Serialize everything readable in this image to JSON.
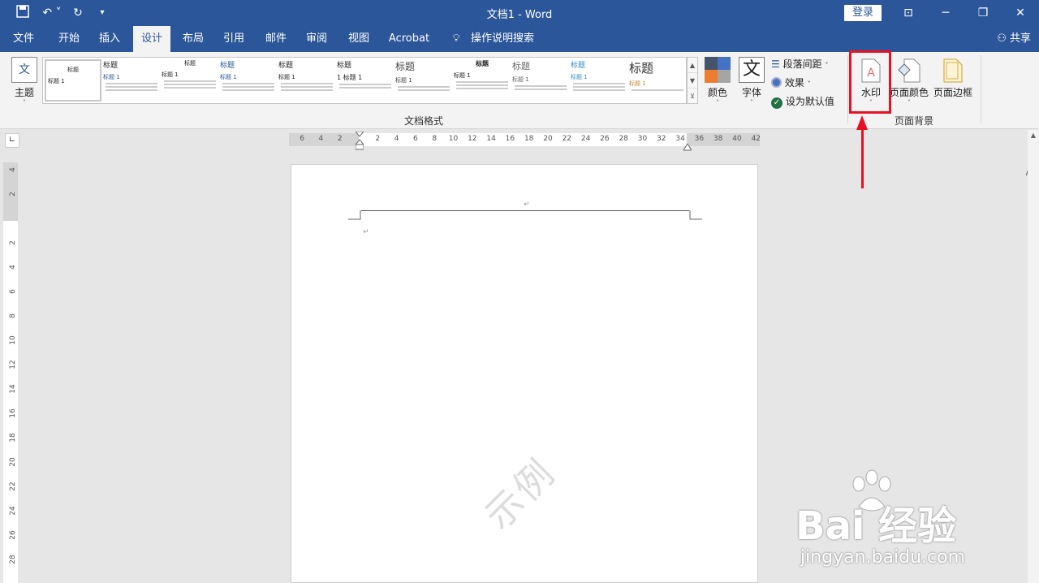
{
  "titlebar": {
    "doc_title": "文档1 - Word",
    "login_label": "登录"
  },
  "tabs": [
    {
      "label": "文件"
    },
    {
      "label": "开始"
    },
    {
      "label": "插入"
    },
    {
      "label": "设计"
    },
    {
      "label": "布局"
    },
    {
      "label": "引用"
    },
    {
      "label": "邮件"
    },
    {
      "label": "审阅"
    },
    {
      "label": "视图"
    },
    {
      "label": "Acrobat"
    },
    {
      "label": "操作说明搜索"
    }
  ],
  "share_label": "共享",
  "ribbon": {
    "theme_label": "主题",
    "style_gallery": [
      {
        "title": "标题",
        "heading": "标题 1"
      },
      {
        "title": "标题",
        "heading": "标题 1"
      },
      {
        "title": "标题",
        "heading": "标题 1"
      },
      {
        "title": "标题",
        "heading": "标题 1"
      },
      {
        "title": "标题",
        "heading": "标题 1"
      },
      {
        "title": "标题",
        "heading": "1 标题 1"
      },
      {
        "title": "标题",
        "heading": "标题 1"
      },
      {
        "title": "标题",
        "heading": "标题 1"
      },
      {
        "title": "标题",
        "heading": "标题 1"
      },
      {
        "title": "标题",
        "heading": "标题 1"
      },
      {
        "title": "标题",
        "heading": "标题 1"
      }
    ],
    "doc_format_group": "文档格式",
    "colors_label": "颜色",
    "fonts_label": "字体",
    "fonts_icon_text": "文",
    "paragraph_spacing": "段落间距",
    "effects": "效果",
    "set_default": "设为默认值",
    "watermark_label": "水印",
    "page_color_label": "页面颜色",
    "page_border_label": "页面边框",
    "page_bg_group": "页面背景"
  },
  "ruler": {
    "h_ticks": [
      "6",
      "4",
      "2",
      "2",
      "4",
      "6",
      "8",
      "10",
      "12",
      "14",
      "16",
      "18",
      "20",
      "22",
      "24",
      "26",
      "28",
      "30",
      "32",
      "34",
      "36",
      "38",
      "40",
      "42"
    ],
    "v_ticks": [
      "4",
      "2",
      "2",
      "4",
      "6",
      "8",
      "10",
      "12",
      "14",
      "16",
      "18",
      "20",
      "22",
      "24",
      "26",
      "28"
    ]
  },
  "document": {
    "watermark_text": "示例"
  },
  "brand": {
    "main": "Bai 经验",
    "sub": "jingyan.baidu.com"
  },
  "colors": {
    "accent": "#2b579a",
    "highlight": "#e81123"
  }
}
